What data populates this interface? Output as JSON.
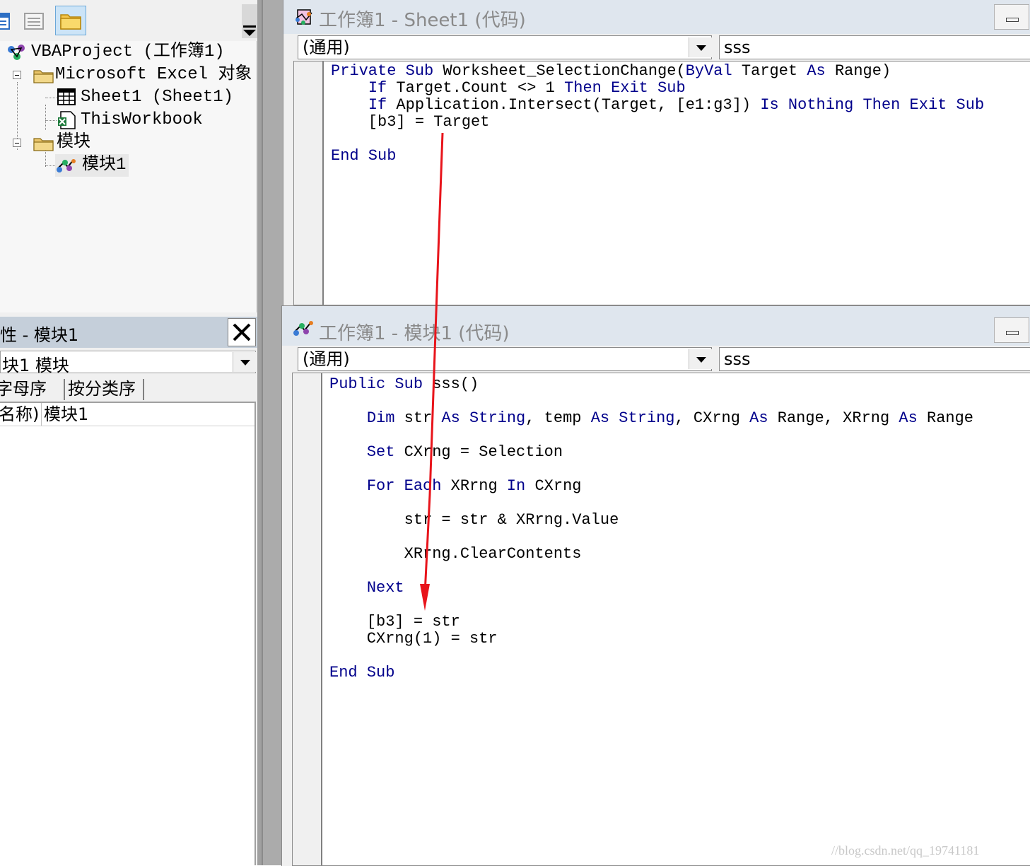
{
  "project": {
    "root": "VBAProject (工作簿1)",
    "folder_excel": "Microsoft Excel 对象",
    "sheet": "Sheet1 (Sheet1)",
    "workbook": "ThisWorkbook",
    "folder_modules": "模块",
    "module": "模块1"
  },
  "properties": {
    "title": "性 - 模块1",
    "object_select": "块1 模块",
    "tab_alpha": "字母序",
    "tab_category": "按分类序",
    "row_name": "名称)",
    "row_value": "模块1"
  },
  "sheet_window": {
    "title": "工作簿1 - Sheet1 (代码)",
    "object_combo": "(通用)",
    "proc_combo": "sss",
    "code": [
      [
        {
          "t": "Private Sub",
          "k": 1
        },
        {
          "t": " Worksheet_SelectionChange("
        },
        {
          "t": "ByVal",
          "k": 1
        },
        {
          "t": " Target "
        },
        {
          "t": "As",
          "k": 1
        },
        {
          "t": " Range)"
        }
      ],
      [
        {
          "t": "    "
        },
        {
          "t": "If",
          "k": 1
        },
        {
          "t": " Target.Count <> 1 "
        },
        {
          "t": "Then Exit Sub",
          "k": 1
        }
      ],
      [
        {
          "t": "    "
        },
        {
          "t": "If",
          "k": 1
        },
        {
          "t": " Application.Intersect(Target, [e1:g3]) "
        },
        {
          "t": "Is Nothing Then Exit Sub",
          "k": 1
        }
      ],
      [
        {
          "t": "    [b3] = Target"
        }
      ],
      [],
      [
        {
          "t": "End Sub",
          "k": 1
        }
      ]
    ]
  },
  "module_window": {
    "title": "工作簿1 - 模块1 (代码)",
    "object_combo": "(通用)",
    "proc_combo": "sss",
    "code": [
      [
        {
          "t": "Public Sub",
          "k": 1
        },
        {
          "t": " sss()"
        }
      ],
      [],
      [
        {
          "t": "    "
        },
        {
          "t": "Dim",
          "k": 1
        },
        {
          "t": " str "
        },
        {
          "t": "As String",
          "k": 1
        },
        {
          "t": ", temp "
        },
        {
          "t": "As String",
          "k": 1
        },
        {
          "t": ", CXrng "
        },
        {
          "t": "As",
          "k": 1
        },
        {
          "t": " Range, XRrng "
        },
        {
          "t": "As",
          "k": 1
        },
        {
          "t": " Range"
        }
      ],
      [],
      [
        {
          "t": "    "
        },
        {
          "t": "Set",
          "k": 1
        },
        {
          "t": " CXrng = Selection"
        }
      ],
      [],
      [
        {
          "t": "    "
        },
        {
          "t": "For Each",
          "k": 1
        },
        {
          "t": " XRrng "
        },
        {
          "t": "In",
          "k": 1
        },
        {
          "t": " CXrng"
        }
      ],
      [],
      [
        {
          "t": "        str = str & XRrng.Value"
        }
      ],
      [],
      [
        {
          "t": "        XRrng.ClearContents"
        }
      ],
      [],
      [
        {
          "t": "    "
        },
        {
          "t": "Next",
          "k": 1
        }
      ],
      [],
      [
        {
          "t": "    [b3] = str"
        }
      ],
      [
        {
          "t": "    CXrng(1) = str"
        }
      ],
      [],
      [
        {
          "t": "End Sub",
          "k": 1
        }
      ]
    ]
  },
  "watermark": "//blog.csdn.net/qq_19741181",
  "colors": {
    "keyword": "#00008b",
    "annotation_arrow": "#e8141b"
  }
}
